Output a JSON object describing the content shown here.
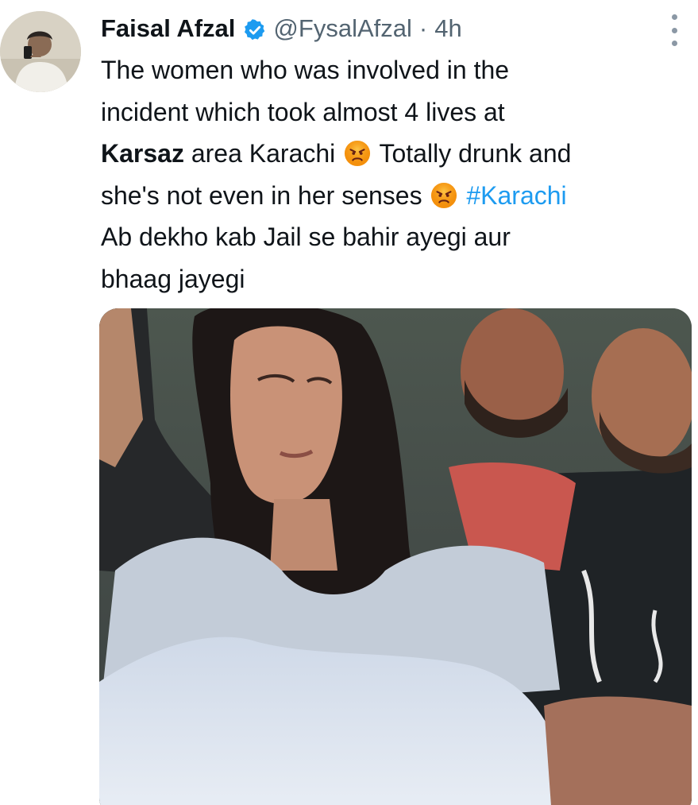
{
  "author": {
    "display_name": "Faisal Afzal",
    "handle": "@FysalAfzal",
    "separator": "·",
    "timestamp": "4h",
    "verified": true,
    "avatar_icon": "profile-photo"
  },
  "tweet": {
    "line1": "The women who was involved in the",
    "line2": "incident which took almost 4 lives at",
    "line3_bold": "Karsaz",
    "line3_rest": " area Karachi ",
    "line3_tail": " Totally drunk and",
    "line4_a": "she's not even in her senses ",
    "line4_hashtag": "#Karachi",
    "line5": "Ab dekho kab Jail se bahir ayegi aur",
    "line6": "bhaag jayegi",
    "emoji": "angry-face-emoji"
  },
  "media": {
    "type": "video-still",
    "description_icon": "photo"
  },
  "colors": {
    "text": "#0f1419",
    "secondary": "#536471",
    "link": "#1d9bf0",
    "verified": "#1d9bf0"
  }
}
